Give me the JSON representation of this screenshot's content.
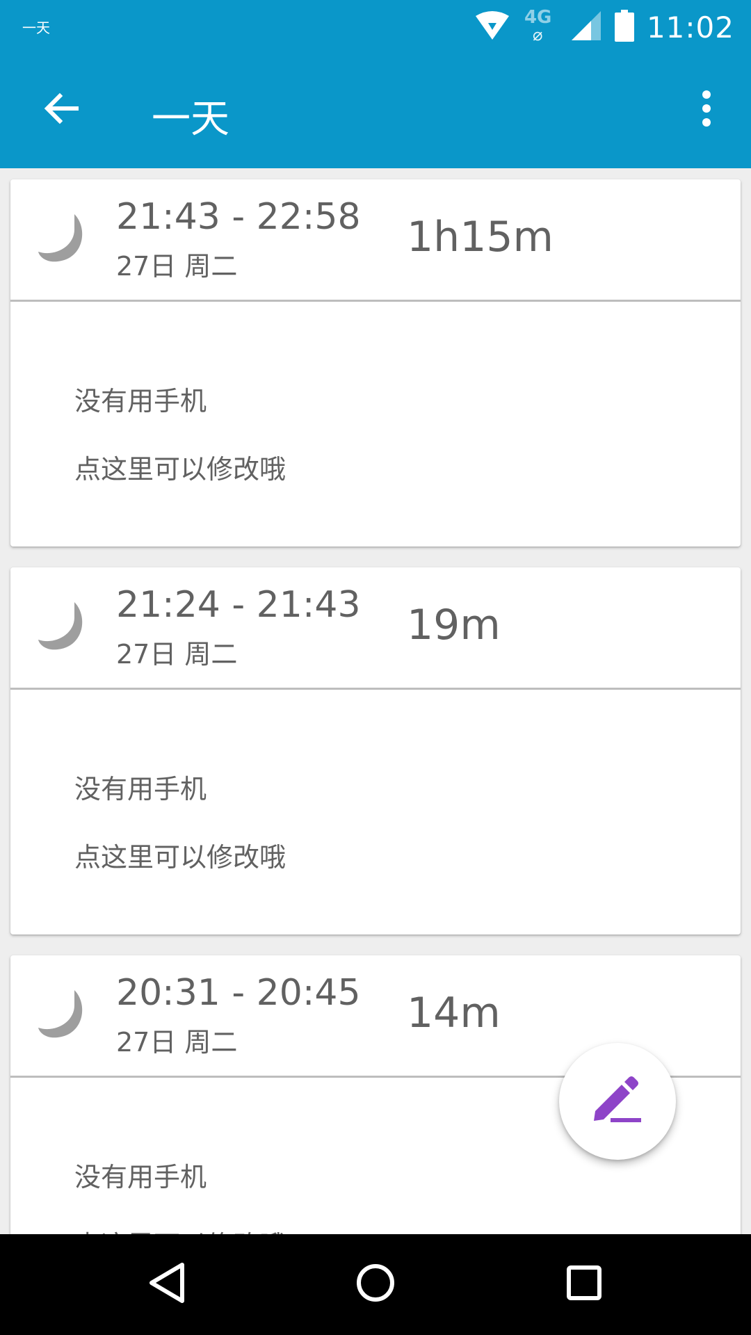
{
  "status_bar": {
    "left_text": "一天",
    "network": "4G",
    "time": "11:02",
    "icons": [
      "wifi-icon",
      "mobile-data-icon",
      "signal-icon",
      "battery-icon"
    ]
  },
  "app_bar": {
    "title": "一天",
    "back_icon": "arrow-back-icon",
    "more_icon": "more-vert-icon",
    "color": "#0a97c9"
  },
  "records": [
    {
      "time_range": "21:43 - 22:58",
      "date": "27日 周二",
      "duration": "1h15m",
      "note_line1": "没有用手机",
      "note_line2": "点这里可以修改哦",
      "icon": "moon-icon"
    },
    {
      "time_range": "21:24 - 21:43",
      "date": "27日 周二",
      "duration": "19m",
      "note_line1": "没有用手机",
      "note_line2": "点这里可以修改哦",
      "icon": "moon-icon"
    },
    {
      "time_range": "20:31 - 20:45",
      "date": "27日 周二",
      "duration": "14m",
      "note_line1": "没有用手机",
      "note_line2": "点这里可以修改哦",
      "icon": "moon-icon"
    }
  ],
  "fab": {
    "icon": "edit-icon",
    "color": "#8e44c8"
  },
  "nav_bar": {
    "icons": [
      "nav-back-icon",
      "nav-home-icon",
      "nav-recents-icon"
    ]
  }
}
